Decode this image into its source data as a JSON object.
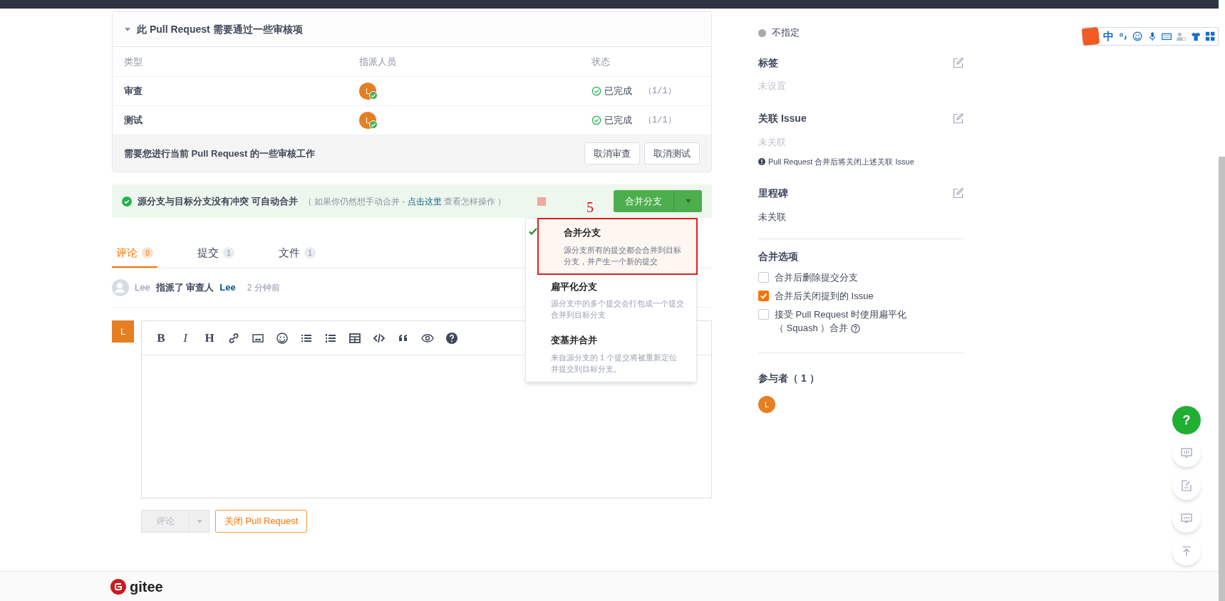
{
  "review_panel": {
    "title": "此 Pull Request 需要通过一些审核项",
    "expanded": true,
    "columns": [
      "类型",
      "指派人员",
      "状态"
    ],
    "rows": [
      {
        "type": "审查",
        "assignee": "L",
        "status": "已完成",
        "count": "（1/1）"
      },
      {
        "type": "测试",
        "assignee": "L",
        "status": "已完成",
        "count": "（1/1）"
      }
    ],
    "footer_text": "需要您进行当前 Pull Request 的一些审核工作",
    "buttons": [
      "取消审查",
      "取消测试"
    ]
  },
  "merge_bar": {
    "message": "源分支与目标分支没有冲突 可自动合并",
    "hint_before": "（ 如果你仍然想手动合并 - ",
    "hint_link": "点击这里",
    "hint_after": " 查看怎样操作 ）",
    "button": "合并分支"
  },
  "annotation": {
    "label": "5"
  },
  "merge_menu": [
    {
      "title": "合并分支",
      "description": "源分支所有的提交都会合并到目标分支，并产生一个新的提交",
      "selected": true
    },
    {
      "title": "扁平化分支",
      "description": "源分支中的多个提交会打包成一个提交合并到目标分支",
      "selected": false
    },
    {
      "title": "变基并合并",
      "description": "来自源分支的 1 个提交将被重新定位并提交到目标分支。",
      "selected": false
    }
  ],
  "tabs": [
    {
      "label": "评论",
      "count": "0",
      "selected": true
    },
    {
      "label": "提交",
      "count": "1",
      "selected": false
    },
    {
      "label": "文件",
      "count": "1",
      "selected": false
    }
  ],
  "activity": {
    "user": "Lee",
    "action": "指派了 审查人",
    "target": "Lee",
    "time": "2 分钟前"
  },
  "editor": {
    "avatar": "L",
    "toolbar": [
      "B",
      "I",
      "H"
    ],
    "submit": "评论",
    "close": "关闭 Pull Request"
  },
  "sidebar": {
    "priority": "不指定",
    "sections": [
      {
        "title": "标签",
        "value": "未设置",
        "muted": true
      },
      {
        "title": "关联 Issue",
        "value": "未关联",
        "muted": true,
        "note": "Pull Request 合并后将关闭上述关联 Issue"
      },
      {
        "title": "里程碑",
        "value": "未关联",
        "muted": false
      }
    ],
    "merge_options_title": "合并选项",
    "merge_options": [
      {
        "label": "合并后删除提交分支",
        "checked": false
      },
      {
        "label": "合并后关闭提到的 Issue",
        "checked": true
      },
      {
        "label": "接受 Pull Request 时使用扁平化",
        "label_continued": "（ Squash ）合并",
        "checked": false
      }
    ],
    "participants_title": "参与者（ 1 ）",
    "participants": [
      "L"
    ]
  },
  "ime_toolbar": {
    "label": "中"
  },
  "float_buttons": {
    "help": "?"
  },
  "footer": {
    "logo": "gitee"
  }
}
